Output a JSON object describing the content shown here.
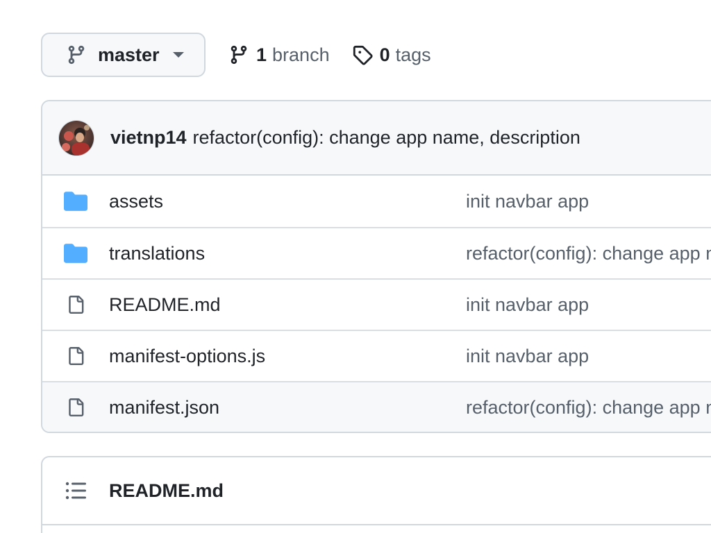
{
  "branch_selector": {
    "icon": "git-branch-icon",
    "current_branch": "master",
    "caret_icon": "caret-down-icon"
  },
  "branches_link": {
    "icon": "git-branch-icon",
    "count": "1",
    "label": "branch"
  },
  "tags_link": {
    "icon": "tag-icon",
    "count": "0",
    "label": "tags"
  },
  "latest_commit": {
    "author": "vietnp14",
    "message": "refactor(config): change app name, description"
  },
  "files": [
    {
      "type": "folder",
      "icon": "folder-icon",
      "name": "assets",
      "commit_message": "init navbar app"
    },
    {
      "type": "folder",
      "icon": "folder-icon",
      "name": "translations",
      "commit_message": "refactor(config): change app name, description"
    },
    {
      "type": "file",
      "icon": "file-icon",
      "name": "README.md",
      "commit_message": "init navbar app"
    },
    {
      "type": "file",
      "icon": "file-icon",
      "name": "manifest-options.js",
      "commit_message": "init navbar app"
    },
    {
      "type": "file",
      "icon": "file-icon",
      "name": "manifest.json",
      "commit_message": "refactor(config): change app name, description"
    }
  ],
  "readme": {
    "icon": "list-icon",
    "title": "README.md"
  },
  "colors": {
    "folder": "#54aeff",
    "border": "#d0d7de",
    "header_bg": "#f6f8fa",
    "muted_text": "#57606a",
    "text": "#1f2328"
  }
}
